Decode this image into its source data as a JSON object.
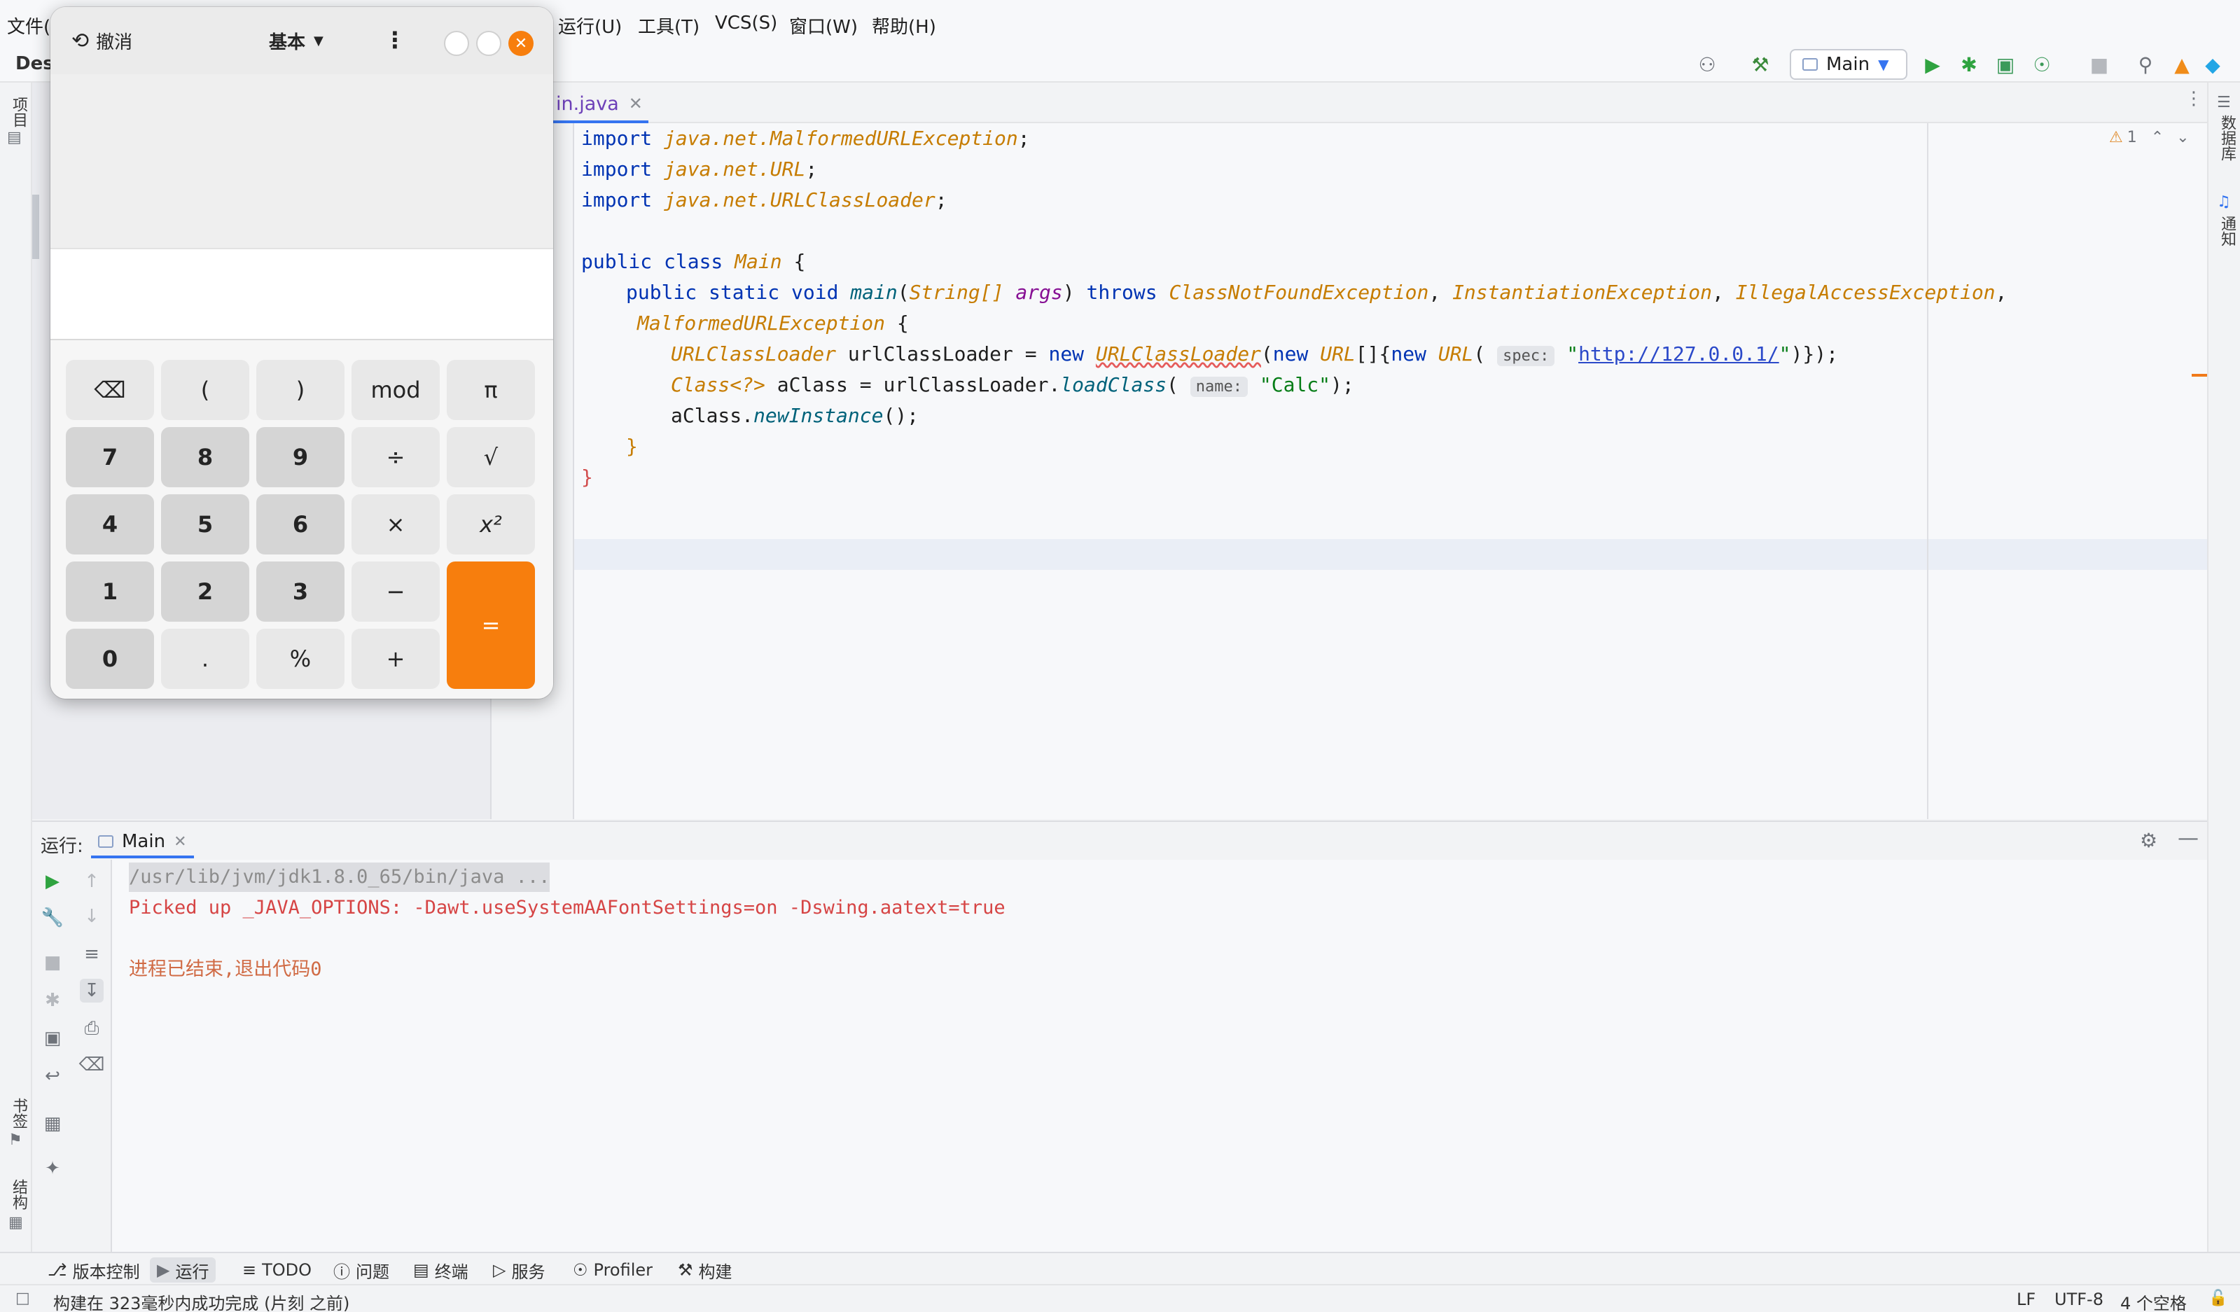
{
  "ide": {
    "menu": [
      "文件(",
      "运行(U)",
      "工具(T)",
      "VCS(S)",
      "窗口(W)",
      "帮助(H)"
    ],
    "toolbar_left_label": "Des",
    "run_config": "Main",
    "left_stripe": {
      "project": "项目",
      "bookmarks": "书签",
      "structure": "结构"
    },
    "right_stripe": {
      "database": "数据库",
      "notifications": "通知"
    },
    "editor": {
      "tab_label": "in.java",
      "warning_count": "1",
      "lines": [
        {
          "t": "import",
          "p": "java.net.MalformedURLException"
        },
        {
          "t": "import",
          "p": "java.net.URL"
        },
        {
          "t": "import",
          "p": "java.net.URLClassLoader"
        }
      ],
      "code": {
        "class_decl_kw": "public class ",
        "class_name": "Main",
        "open_brace": " {",
        "method_kw": "public static void ",
        "method_name": "main",
        "param_type": "String[]",
        "param_name": "args",
        "throws_kw": "throws",
        "ex1": "ClassNotFoundException",
        "ex2": "InstantiationException",
        "ex3": "IllegalAccessException",
        "ex4": "MalformedURLException",
        "loader_type": "URLClassLoader",
        "loader_var": "urlClassLoader",
        "new_kw": "new",
        "url_type": "URL",
        "spec_hint": "spec:",
        "url_string": "http://127.0.0.1/",
        "class_generic": "Class<?>",
        "a_class_var": "aClass",
        "load_class": "loadClass",
        "name_hint": "name:",
        "calc_string": "\"Calc\"",
        "new_instance": "newInstance",
        "close_method": "}",
        "close_class": "}"
      }
    },
    "run": {
      "label": "运行:",
      "tab": "Main",
      "console": [
        "/usr/lib/jvm/jdk1.8.0_65/bin/java ...",
        "Picked up _JAVA_OPTIONS: -Dawt.useSystemAAFontSettings=on -Dswing.aatext=true",
        "",
        "进程已结束,退出代码0"
      ]
    },
    "tool_windows": [
      "版本控制",
      "运行",
      "TODO",
      "问题",
      "终端",
      "服务",
      "Profiler",
      "构建"
    ],
    "status": {
      "message": "构建在 323毫秒内成功完成 (片刻 之前)",
      "line_sep": "LF",
      "encoding": "UTF-8",
      "indent": "4 个空格"
    }
  },
  "calculator": {
    "undo_label": "撤消",
    "mode_label": "基本",
    "keys": [
      [
        "⌫",
        "(",
        ")",
        "mod",
        "π"
      ],
      [
        "7",
        "8",
        "9",
        "÷",
        "√"
      ],
      [
        "4",
        "5",
        "6",
        "×",
        "x²"
      ],
      [
        "1",
        "2",
        "3",
        "−",
        "="
      ],
      [
        "0",
        ".",
        "%",
        "+"
      ]
    ],
    "accent_color": "#f77e0d"
  }
}
